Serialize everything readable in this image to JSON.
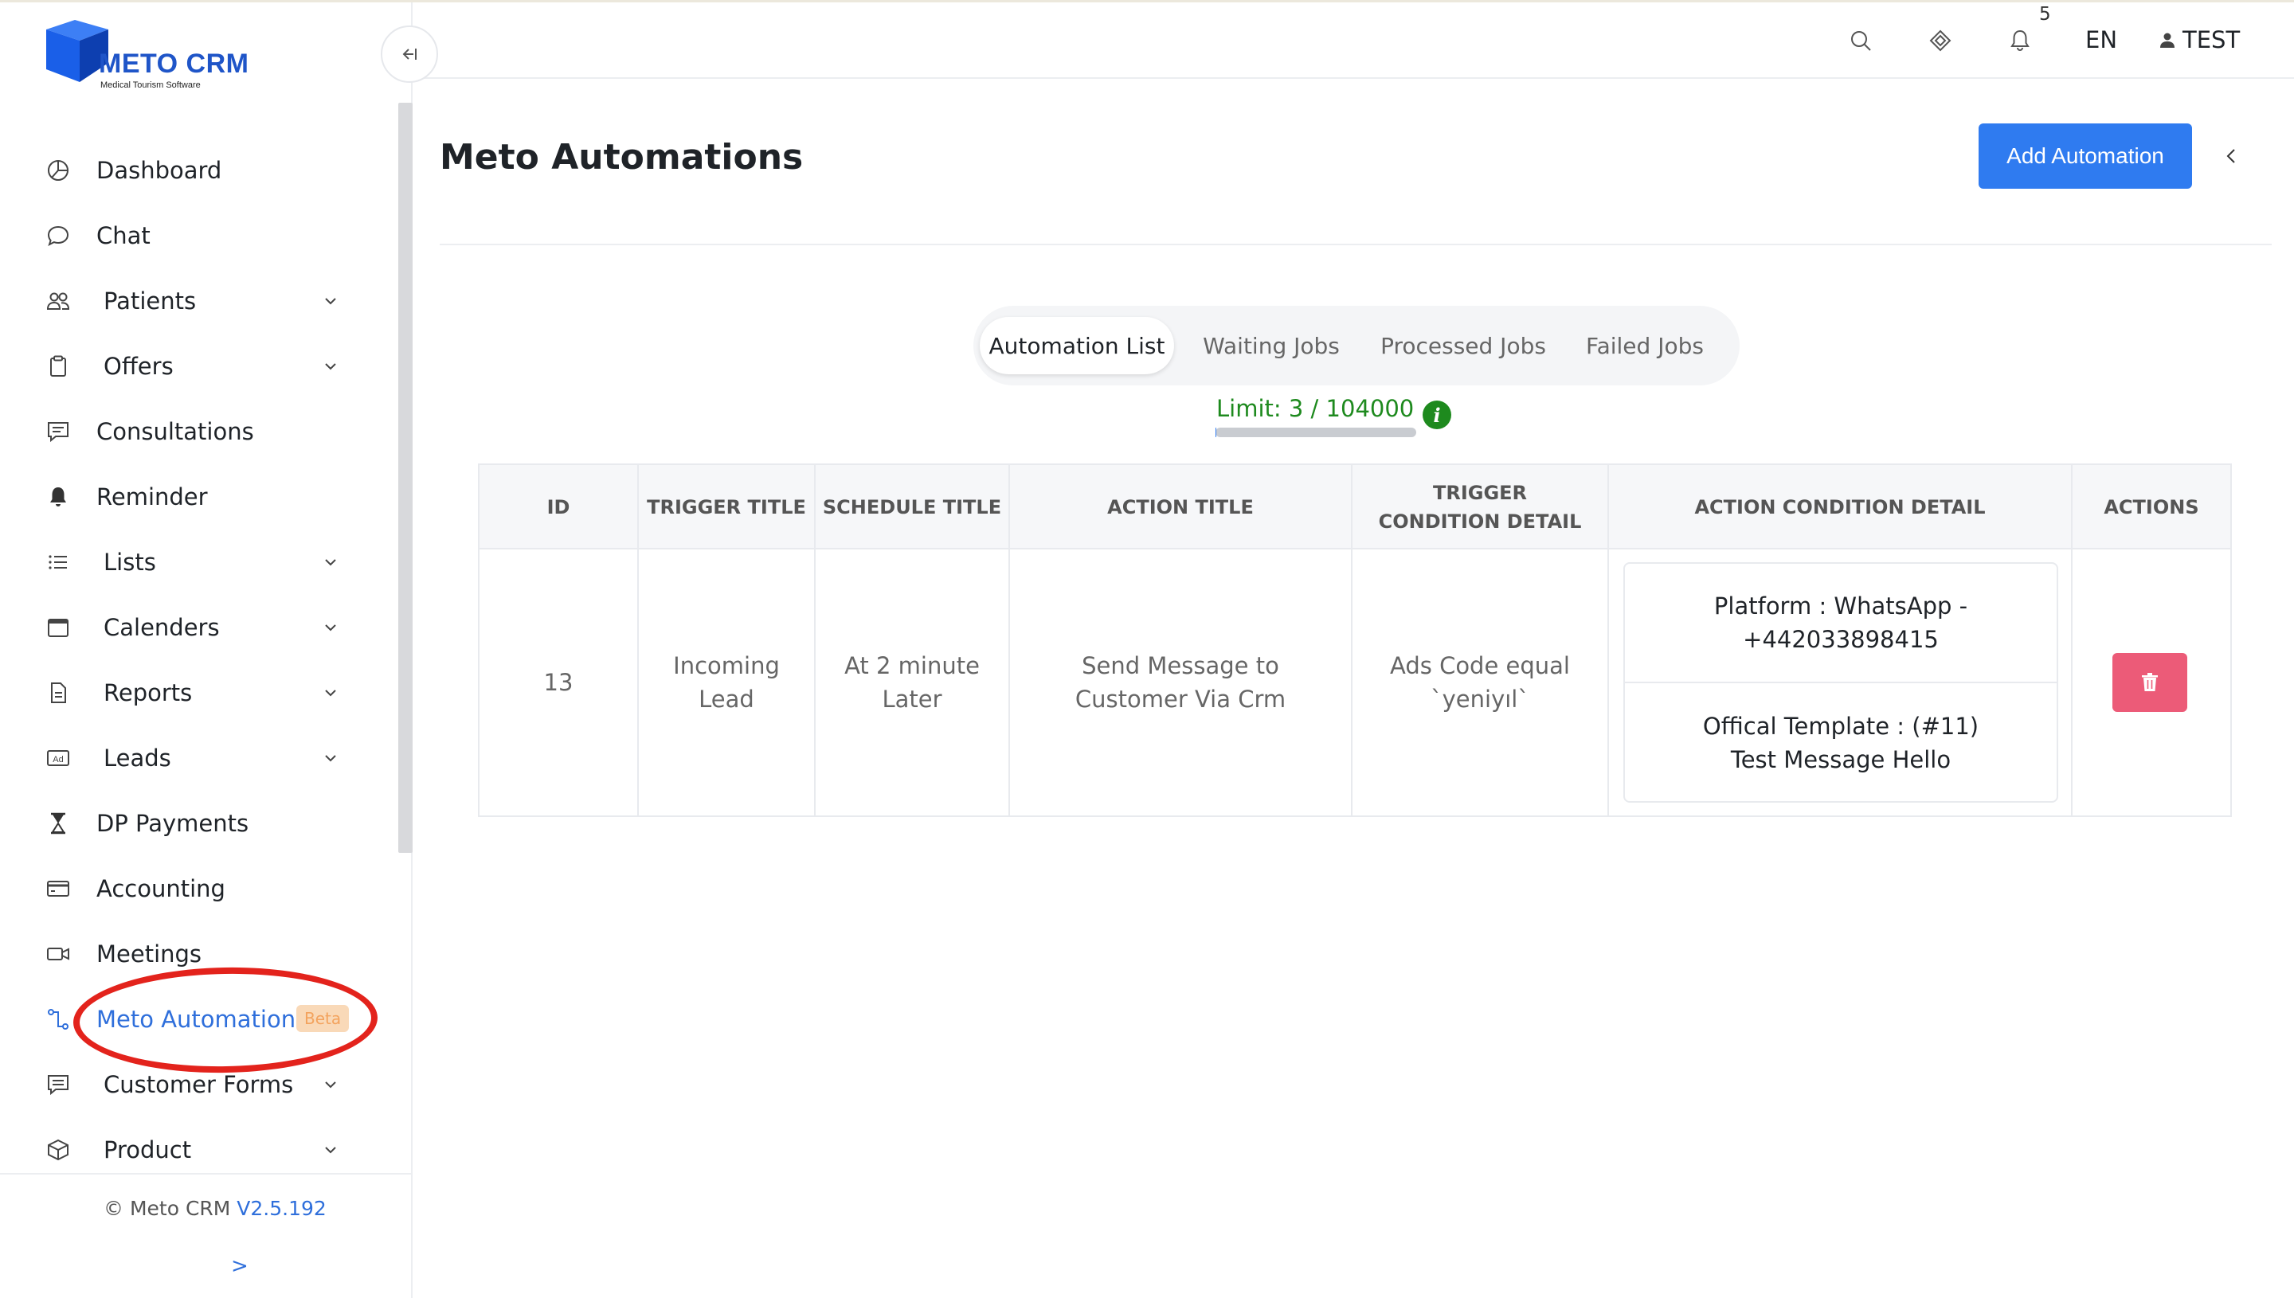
{
  "app": {
    "logo_text": "METO CRM",
    "logo_subtitle": "Medical Tourism Software"
  },
  "sidebar": {
    "items": [
      {
        "label": "Dashboard",
        "icon": "dashboard-icon",
        "has_children": false
      },
      {
        "label": "Chat",
        "icon": "chat-icon",
        "has_children": false
      },
      {
        "label": "Patients",
        "icon": "patients-icon",
        "has_children": true
      },
      {
        "label": "Offers",
        "icon": "clipboard-icon",
        "has_children": true
      },
      {
        "label": "Consultations",
        "icon": "consultations-icon",
        "has_children": false
      },
      {
        "label": "Reminder",
        "icon": "bell-icon",
        "has_children": false
      },
      {
        "label": "Lists",
        "icon": "list-icon",
        "has_children": true
      },
      {
        "label": "Calenders",
        "icon": "calendar-icon",
        "has_children": true
      },
      {
        "label": "Reports",
        "icon": "report-icon",
        "has_children": true
      },
      {
        "label": "Leads",
        "icon": "ad-icon",
        "has_children": true
      },
      {
        "label": "DP Payments",
        "icon": "hourglass-icon",
        "has_children": false
      },
      {
        "label": "Accounting",
        "icon": "credit-card-icon",
        "has_children": false
      },
      {
        "label": "Meetings",
        "icon": "video-icon",
        "has_children": false
      },
      {
        "label": "Meto Automations",
        "icon": "automation-icon",
        "has_children": false,
        "active": true,
        "badge": "Beta"
      },
      {
        "label": "Customer Forms",
        "icon": "form-icon",
        "has_children": true
      },
      {
        "label": "Product",
        "icon": "box-icon",
        "has_children": true
      }
    ],
    "footer": {
      "copyright": "© Meto CRM",
      "version": "V2.5.192",
      "arrow": ">"
    }
  },
  "topbar": {
    "notification_count": "5",
    "language": "EN",
    "user_name": "TEST"
  },
  "main": {
    "title": "Meto Automations",
    "add_button_label": "Add Automation",
    "tabs": [
      {
        "label": "Automation List",
        "active": true
      },
      {
        "label": "Waiting Jobs",
        "active": false
      },
      {
        "label": "Processed Jobs",
        "active": false
      },
      {
        "label": "Failed Jobs",
        "active": false
      }
    ],
    "limit_text": "Limit: 3 / 104000",
    "limit_used": 3,
    "limit_total": 104000,
    "info_glyph": "i",
    "table": {
      "headers": [
        "ID",
        "TRIGGER TITLE",
        "SCHEDULE TITLE",
        "ACTION TITLE",
        "TRIGGER CONDITION DETAIL",
        "ACTION CONDITION DETAIL",
        "ACTIONS"
      ],
      "rows": [
        {
          "id": "13",
          "trigger_title": "Incoming Lead",
          "schedule_title": "At 2 minute Later",
          "action_title": "Send Message to Customer Via Crm",
          "trigger_condition_detail": "Ads Code equal `yeniyıl`",
          "action_condition_detail": [
            "Platform : WhatsApp - +442033898415",
            "Offical Template : (#11) Test Message Hello"
          ]
        }
      ]
    }
  },
  "colors": {
    "primary": "#2f7bf0",
    "active_menu": "#2f6fdb",
    "limit_green": "#1e8a1e",
    "delete_button": "#ec5b78",
    "beta_bg": "#f9d9b8",
    "beta_text": "#f3a35e",
    "annotation_red": "#e3231c"
  }
}
